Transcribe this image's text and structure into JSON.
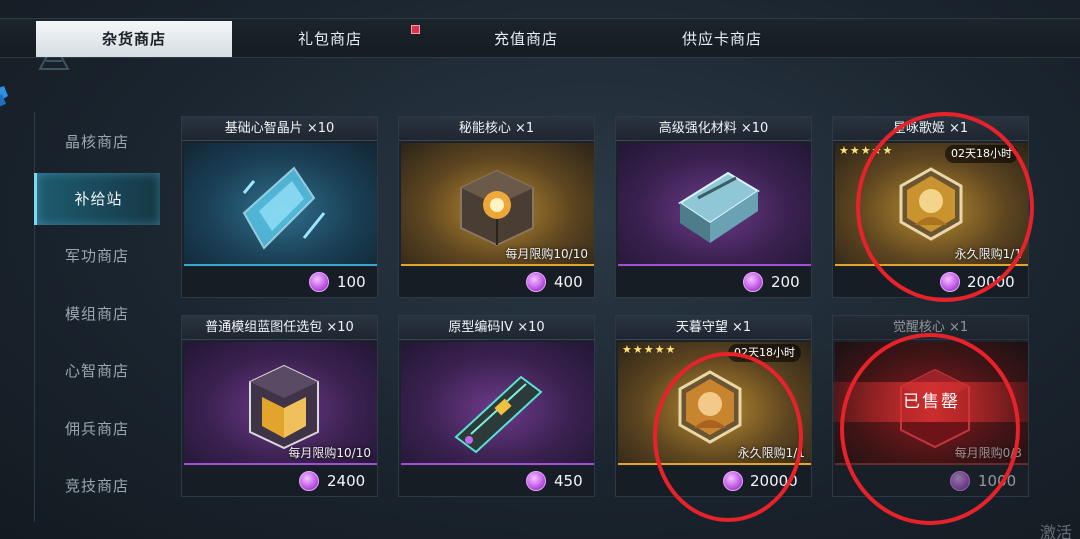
{
  "tabs": [
    {
      "label": "杂货商店",
      "active": true
    },
    {
      "label": "礼包商店",
      "active": false,
      "badge": true
    },
    {
      "label": "充值商店",
      "active": false
    },
    {
      "label": "供应卡商店",
      "active": false
    }
  ],
  "sidebar": {
    "items": [
      {
        "label": "晶核商店"
      },
      {
        "label": "补给站"
      },
      {
        "label": "军功商店"
      },
      {
        "label": "模组商店"
      },
      {
        "label": "心智商店"
      },
      {
        "label": "佣兵商店"
      },
      {
        "label": "竞技商店"
      }
    ],
    "active_index": 1
  },
  "items": [
    {
      "title": "基础心智晶片 ×10",
      "price": "100",
      "theme": "blue"
    },
    {
      "title": "秘能核心 ×1",
      "price": "400",
      "theme": "gold",
      "limit": "每月限购10/10"
    },
    {
      "title": "高级强化材料 ×10",
      "price": "200",
      "theme": "purple"
    },
    {
      "title": "星咏歌姬 ×1",
      "price": "20000",
      "theme": "gold",
      "stars": "★★★★★",
      "timer": "02天18小时",
      "limit": "永久限购1/1"
    },
    {
      "title": "普通模组蓝图任选包 ×10",
      "price": "2400",
      "theme": "purple",
      "limit": "每月限购10/10"
    },
    {
      "title": "原型编码IV ×10",
      "price": "450",
      "theme": "purple"
    },
    {
      "title": "天暮守望 ×1",
      "price": "20000",
      "theme": "gold",
      "stars": "★★★★★",
      "timer": "02天18小时",
      "limit": "永久限购1/1"
    },
    {
      "title": "觉醒核心 ×1",
      "price": "1000",
      "theme": "red",
      "limit": "每月限购0/3",
      "sold_label": "已售罄"
    }
  ],
  "footer": {
    "watermark": "激活"
  },
  "colors": {
    "annotation_circle": "#e8222b",
    "coin": "#c45de8",
    "accent_active": "#7fd8ef"
  }
}
